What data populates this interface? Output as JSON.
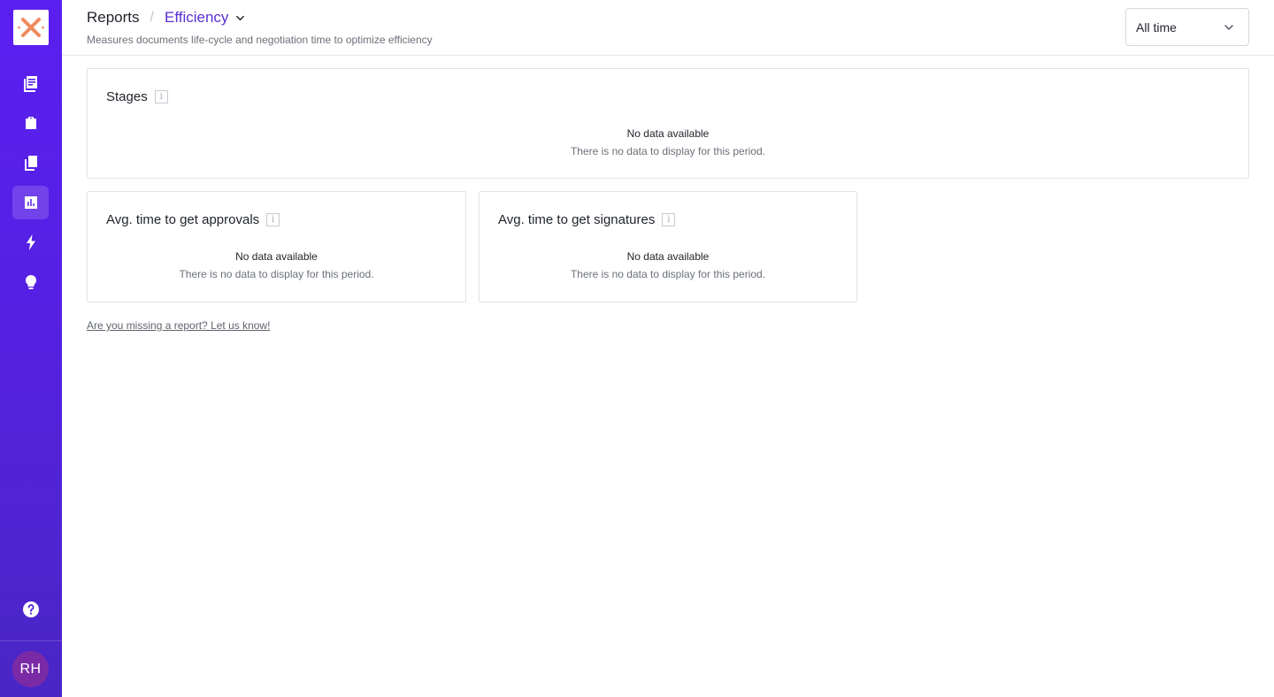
{
  "sidebar": {
    "logo": "close-x-logo",
    "nav": [
      {
        "name": "documents",
        "icon": "document-list-icon"
      },
      {
        "name": "templates",
        "icon": "suitcase-icon"
      },
      {
        "name": "library",
        "icon": "copy-icon"
      },
      {
        "name": "reports",
        "icon": "bar-chart-icon",
        "active": true
      },
      {
        "name": "automations",
        "icon": "lightning-icon"
      },
      {
        "name": "ideas",
        "icon": "lightbulb-icon"
      }
    ],
    "help_icon": "help-icon",
    "avatar_initials": "RH",
    "accent": "#5a1ff0"
  },
  "header": {
    "breadcrumb_root": "Reports",
    "breadcrumb_separator": "/",
    "breadcrumb_current": "Efficiency",
    "subtitle": "Measures documents life-cycle and negotiation time to optimize efficiency",
    "period_selected": "All time"
  },
  "cards": {
    "stages": {
      "title": "Stages",
      "empty_title": "No data available",
      "empty_desc": "There is no data to display for this period."
    },
    "approvals": {
      "title": "Avg. time to get approvals",
      "empty_title": "No data available",
      "empty_desc": "There is no data to display for this period."
    },
    "signatures": {
      "title": "Avg. time to get signatures",
      "empty_title": "No data available",
      "empty_desc": "There is no data to display for this period."
    }
  },
  "feedback_link": "Are you missing a report? Let us know!",
  "info_glyph": "i"
}
